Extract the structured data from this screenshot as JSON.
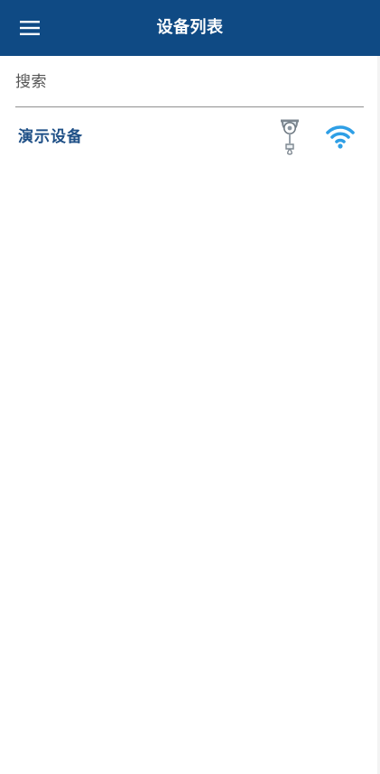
{
  "app_bar": {
    "menu_icon": "hamburger-menu-icon",
    "title": "设备列表",
    "background_color": "#0f4a84"
  },
  "search": {
    "placeholder": "搜索",
    "value": ""
  },
  "devices": [
    {
      "name": "演示设备",
      "type_icon": "hoist-icon",
      "status_icon": "wifi-icon",
      "status_color": "#2e9fe6"
    }
  ]
}
